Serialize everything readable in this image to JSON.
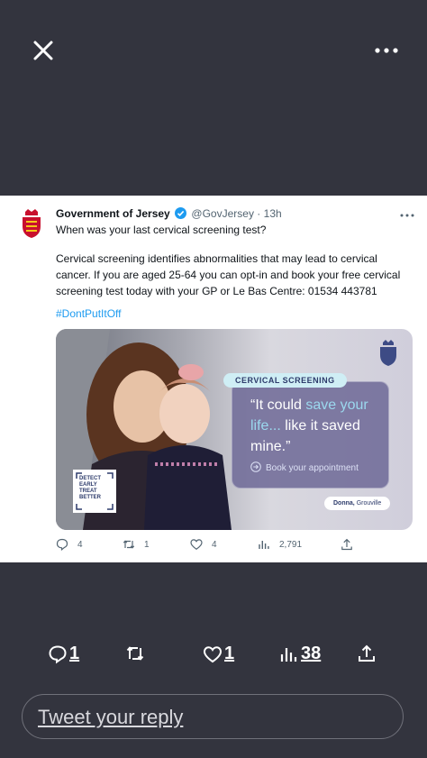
{
  "viewer": {
    "close_icon": "close-icon",
    "more_icon": "more-horizontal-icon"
  },
  "tweet": {
    "author_name": "Government of Jersey",
    "verified": true,
    "handle": "@GovJersey",
    "separator": "·",
    "time": "13h",
    "line1": "When was your last cervical screening test?",
    "body": "Cervical screening identifies abnormalities that may lead to cervical cancer. If you are aged 25-64 you can opt-in and book your free cervical screening test today with your GP or Le Bas Centre: 01534 443781",
    "hashtag": "#DontPutItOff",
    "media": {
      "label": "CERVICAL SCREENING",
      "quote_part1": "“It could ",
      "quote_highlight": "save your life...",
      "quote_part2": " like it saved mine.”",
      "cta": "Book your appointment",
      "caption_name": "Donna,",
      "caption_place": "Grouville",
      "badge_lines": [
        "DETECT",
        "EARLY",
        "TREAT",
        "BETTER"
      ]
    },
    "actions": {
      "replies": "4",
      "retweets": "1",
      "likes": "4",
      "views": "2,791"
    }
  },
  "bottom_bar": {
    "replies": "1",
    "likes": "1",
    "views": "38"
  },
  "reply_input": {
    "placeholder": "Tweet your reply"
  },
  "colors": {
    "background": "#33343e",
    "card": "#ffffff",
    "link": "#1d9bf0",
    "verified": "#1d9bf0"
  }
}
